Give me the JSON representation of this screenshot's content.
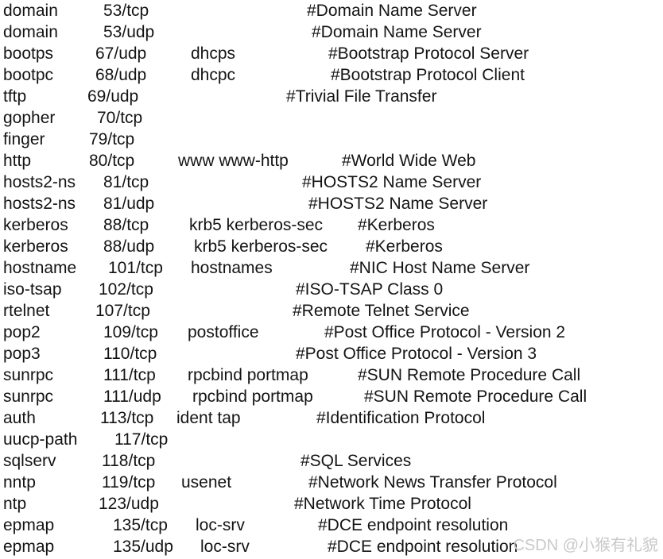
{
  "document": {
    "kind": "services-file-listing",
    "background_color": "#ffffff",
    "text_color": "#141414",
    "line_height_px": 27,
    "font_size_px": 21,
    "columns": [
      "service",
      "port_protocol",
      "aliases",
      "comment"
    ]
  },
  "watermark": {
    "text": "CSDN @小猴有礼貌",
    "color": "#c9c9c9"
  },
  "rows": [
    {
      "service": "domain",
      "port": "53/tcp",
      "aliases": "",
      "comment": "#Domain Name Server",
      "x": {
        "service": 4,
        "port": 130,
        "aliases": 240,
        "comment": 386
      }
    },
    {
      "service": "domain",
      "port": "53/udp",
      "aliases": "",
      "comment": "#Domain Name Server",
      "x": {
        "service": 4,
        "port": 130,
        "aliases": 240,
        "comment": 392
      }
    },
    {
      "service": "bootps",
      "port": "67/udp",
      "aliases": "dhcps",
      "comment": "#Bootstrap Protocol Server",
      "x": {
        "service": 4,
        "port": 120,
        "aliases": 240,
        "comment": 413
      }
    },
    {
      "service": "bootpc",
      "port": "68/udp",
      "aliases": "dhcpc",
      "comment": "#Bootstrap Protocol Client",
      "x": {
        "service": 4,
        "port": 120,
        "aliases": 240,
        "comment": 416
      }
    },
    {
      "service": "tftp",
      "port": "69/udp",
      "aliases": "",
      "comment": "#Trivial File Transfer",
      "x": {
        "service": 4,
        "port": 110,
        "aliases": 240,
        "comment": 360
      }
    },
    {
      "service": "gopher",
      "port": "70/tcp",
      "aliases": "",
      "comment": "",
      "x": {
        "service": 4,
        "port": 122,
        "aliases": 240,
        "comment": 360
      }
    },
    {
      "service": "finger",
      "port": "79/tcp",
      "aliases": "",
      "comment": "",
      "x": {
        "service": 4,
        "port": 112,
        "aliases": 240,
        "comment": 360
      }
    },
    {
      "service": "http",
      "port": "80/tcp",
      "aliases": "www www-http",
      "comment": "#World Wide Web",
      "x": {
        "service": 4,
        "port": 112,
        "aliases": 224,
        "comment": 430
      }
    },
    {
      "service": "hosts2-ns",
      "port": "81/tcp",
      "aliases": "",
      "comment": "#HOSTS2 Name Server",
      "x": {
        "service": 4,
        "port": 130,
        "aliases": 240,
        "comment": 380
      }
    },
    {
      "service": "hosts2-ns",
      "port": "81/udp",
      "aliases": "",
      "comment": "#HOSTS2 Name Server",
      "x": {
        "service": 4,
        "port": 130,
        "aliases": 240,
        "comment": 388
      }
    },
    {
      "service": "kerberos",
      "port": "88/tcp",
      "aliases": "krb5 kerberos-sec",
      "comment": "#Kerberos",
      "x": {
        "service": 4,
        "port": 130,
        "aliases": 238,
        "comment": 450
      }
    },
    {
      "service": "kerberos",
      "port": "88/udp",
      "aliases": "krb5 kerberos-sec",
      "comment": "#Kerberos",
      "x": {
        "service": 4,
        "port": 130,
        "aliases": 244,
        "comment": 460
      }
    },
    {
      "service": "hostname",
      "port": "101/tcp",
      "aliases": "hostnames",
      "comment": "#NIC Host Name Server",
      "x": {
        "service": 4,
        "port": 136,
        "aliases": 240,
        "comment": 440
      }
    },
    {
      "service": "iso-tsap",
      "port": "102/tcp",
      "aliases": "",
      "comment": "#ISO-TSAP Class 0",
      "x": {
        "service": 4,
        "port": 124,
        "aliases": 240,
        "comment": 372
      }
    },
    {
      "service": "rtelnet",
      "port": "107/tcp",
      "aliases": "",
      "comment": "#Remote Telnet Service",
      "x": {
        "service": 4,
        "port": 120,
        "aliases": 240,
        "comment": 368
      }
    },
    {
      "service": "pop2",
      "port": "109/tcp",
      "aliases": "postoffice",
      "comment": "#Post Office Protocol - Version 2",
      "x": {
        "service": 4,
        "port": 130,
        "aliases": 236,
        "comment": 408
      }
    },
    {
      "service": "pop3",
      "port": "110/tcp",
      "aliases": "",
      "comment": "#Post Office Protocol - Version 3",
      "x": {
        "service": 4,
        "port": 130,
        "aliases": 240,
        "comment": 372
      }
    },
    {
      "service": "sunrpc",
      "port": "111/tcp",
      "aliases": "rpcbind portmap",
      "comment": "#SUN Remote Procedure Call",
      "x": {
        "service": 4,
        "port": 130,
        "aliases": 236,
        "comment": 450
      }
    },
    {
      "service": "sunrpc",
      "port": "111/udp",
      "aliases": "rpcbind portmap",
      "comment": "#SUN Remote Procedure Call",
      "x": {
        "service": 4,
        "port": 130,
        "aliases": 242,
        "comment": 458
      }
    },
    {
      "service": "auth",
      "port": "113/tcp",
      "aliases": "ident tap",
      "comment": "#Identification Protocol",
      "x": {
        "service": 4,
        "port": 126,
        "aliases": 222,
        "comment": 398
      }
    },
    {
      "service": "uucp-path",
      "port": "117/tcp",
      "aliases": "",
      "comment": "",
      "x": {
        "service": 4,
        "port": 144,
        "aliases": 240,
        "comment": 398
      }
    },
    {
      "service": "sqlserv",
      "port": "118/tcp",
      "aliases": "",
      "comment": "#SQL Services",
      "x": {
        "service": 4,
        "port": 128,
        "aliases": 240,
        "comment": 378
      }
    },
    {
      "service": "nntp",
      "port": "119/tcp",
      "aliases": "usenet",
      "comment": "#Network News Transfer Protocol",
      "x": {
        "service": 4,
        "port": 128,
        "aliases": 228,
        "comment": 388
      }
    },
    {
      "service": "ntp",
      "port": "123/udp",
      "aliases": "",
      "comment": "#Network Time Protocol",
      "x": {
        "service": 4,
        "port": 124,
        "aliases": 240,
        "comment": 370
      }
    },
    {
      "service": "epmap",
      "port": "135/tcp",
      "aliases": "loc-srv",
      "comment": "#DCE endpoint resolution",
      "x": {
        "service": 4,
        "port": 142,
        "aliases": 246,
        "comment": 400
      }
    },
    {
      "service": "epmap",
      "port": "135/udp",
      "aliases": "loc-srv",
      "comment": "#DCE endpoint resolution",
      "x": {
        "service": 4,
        "port": 142,
        "aliases": 252,
        "comment": 412
      }
    }
  ]
}
